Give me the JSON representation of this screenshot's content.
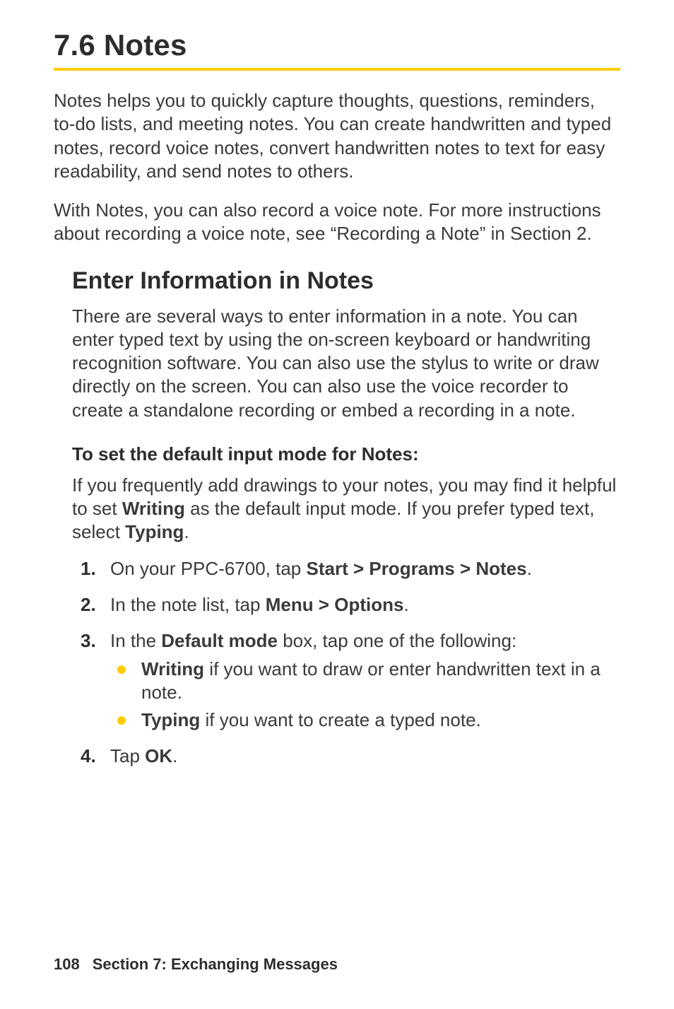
{
  "heading": "7.6   Notes",
  "intro1": "Notes helps you to quickly capture thoughts, questions, reminders, to-do lists, and meeting notes. You can create handwritten and typed notes, record voice notes, convert handwritten notes to text for easy readability, and send notes to others.",
  "intro2": "With Notes, you can also record a voice note. For more instructions about recording a voice note, see “Recording a Note” in Section 2.",
  "subhead": "Enter Information in Notes",
  "subbody": "There are several ways to enter information in a note. You can enter typed text by using the on-screen keyboard or handwriting recognition software. You can also use the stylus to write or draw directly on the screen. You can also use the voice recorder to create a standalone recording or embed a recording in a note.",
  "proc_head": "To set the default input mode for Notes:",
  "proc_intro": {
    "pre": "If you frequently add drawings to your notes, you may find it helpful to set ",
    "b1": "Writing",
    "mid": " as the default input mode. If you prefer typed text, select ",
    "b2": "Typing",
    "post": "."
  },
  "steps": {
    "s1": {
      "pre": "On your PPC-6700, tap ",
      "b": "Start > Programs > Notes",
      "post": "."
    },
    "s2": {
      "pre": "In the note list, tap ",
      "b": "Menu > Options",
      "post": "."
    },
    "s3": {
      "pre": "In the ",
      "b": "Default mode",
      "post": " box, tap one of the following:",
      "bul1": {
        "b": "Writing",
        "txt": " if you want to draw or enter handwritten text in a note."
      },
      "bul2": {
        "b": "Typing",
        "txt": " if you want to create a typed note."
      }
    },
    "s4": {
      "pre": "Tap ",
      "b": "OK",
      "post": "."
    }
  },
  "footer": {
    "page": "108",
    "section": "Section 7: Exchanging Messages"
  }
}
